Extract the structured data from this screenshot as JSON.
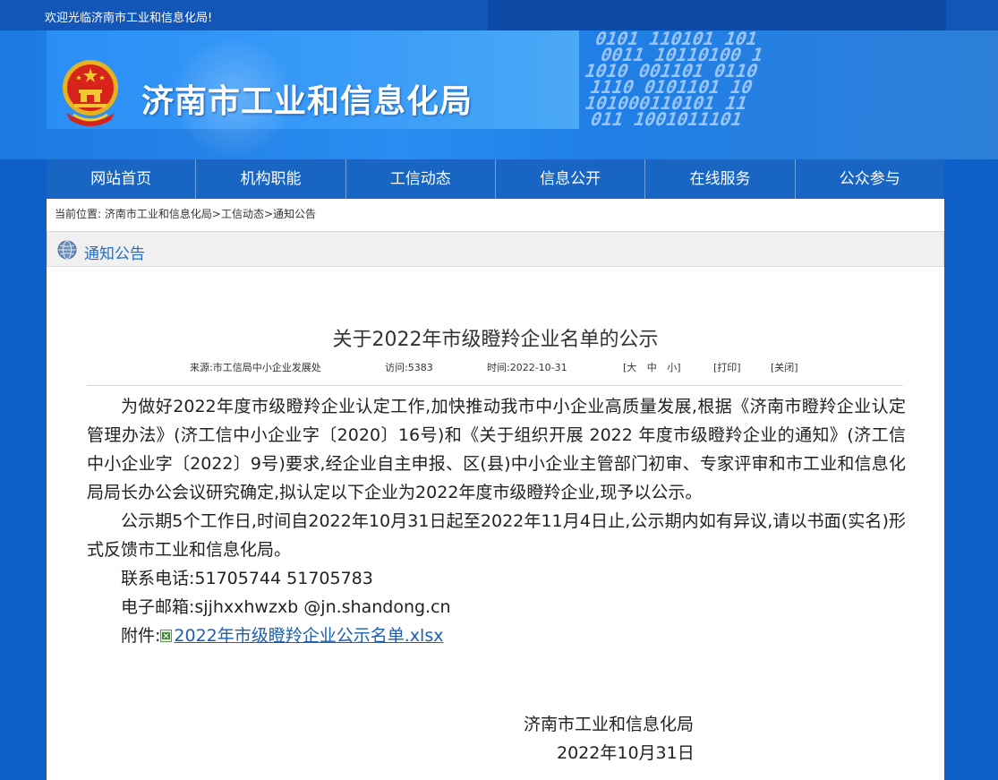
{
  "topbar": {
    "welcome": "欢迎光临济南市工业和信息化局!"
  },
  "header": {
    "site_title": "济南市工业和信息化局",
    "banner_binary": "0101 110101 101\n 0011 10110100 1\n1010 001101 0110\n 1110 0101101 10\n 101000110101 11\n  011 1001011101"
  },
  "nav": {
    "items": [
      {
        "label": "网站首页"
      },
      {
        "label": "机构职能"
      },
      {
        "label": "工信动态"
      },
      {
        "label": "信息公开"
      },
      {
        "label": "在线服务"
      },
      {
        "label": "公众参与"
      }
    ]
  },
  "breadcrumb": {
    "prefix": "当前位置:",
    "items": [
      "济南市工业和信息化局",
      "工信动态",
      "通知公告"
    ],
    "separator": ">"
  },
  "section": {
    "title": "通知公告"
  },
  "article": {
    "title": "关于2022年市级瞪羚企业名单的公示",
    "meta": {
      "source": "来源:市工信局中小企业发展处",
      "visits": "访问:5383",
      "time": "时间:2022-10-31",
      "font_size_label": "[大 中 小]",
      "print_label": "[打印]",
      "close_label": "[关闭]"
    },
    "paragraphs": [
      "为做好2022年度市级瞪羚企业认定工作,加快推动我市中小企业高质量发展,根据《济南市瞪羚企业认定管理办法》(济工信中小企业字〔2020〕16号)和《关于组织开展 2022 年度市级瞪羚企业的通知》(济工信中小企业字〔2022〕9号)要求,经企业自主申报、区(县)中小企业主管部门初审、专家评审和市工业和信息化局局长办公会议研究确定,拟认定以下企业为2022年度市级瞪羚企业,现予以公示。",
      "公示期5个工作日,时间自2022年10月31日起至2022年11月4日止,公示期内如有异议,请以书面(实名)形式反馈市工业和信息化局。",
      "联系电话:51705744 51705783",
      "电子邮箱:sjjhxxhwzxb @jn.shandong.cn"
    ],
    "attachment_label": "附件:",
    "attachment_file": "2022年市级瞪羚企业公示名单.xlsx",
    "signature_org": "济南市工业和信息化局",
    "signature_date": "2022年10月31日"
  },
  "colors": {
    "nav_bg": "#1965c4",
    "link": "#1a5fb4",
    "section_title": "#1e6fc5",
    "page_bg": "#0f5fc8"
  }
}
